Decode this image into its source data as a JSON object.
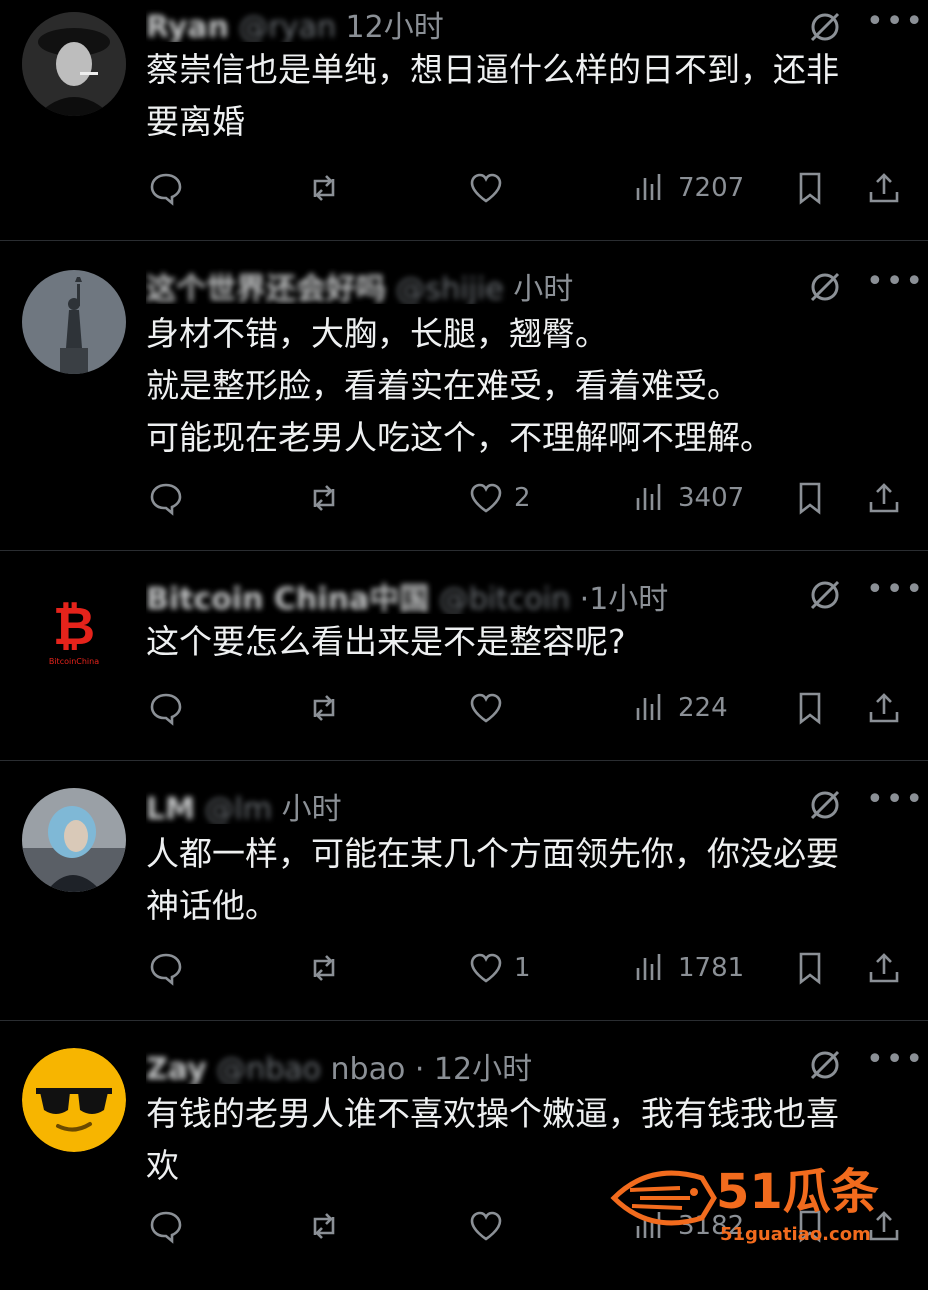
{
  "posts": [
    {
      "name": "Ryan",
      "handle": "@ryan",
      "time": "12小时",
      "text_lines": [
        "蔡崇信也是单纯，想日逼什么样的日不到，还非",
        "要离婚"
      ],
      "likes": "",
      "views": "7207"
    },
    {
      "name": "这个世界还会好吗",
      "handle": "@shijie",
      "time": "小时",
      "text_lines": [
        "身材不错，大胸，长腿，翘臀。",
        "就是整形脸，看着实在难受，看着难受。",
        "可能现在老男人吃这个，不理解啊不理解。"
      ],
      "likes": "2",
      "views": "3407"
    },
    {
      "name": "Bitcoin China中国",
      "handle": "@bitcoin",
      "time": "·1小时",
      "text_lines": [
        "这个要怎么看出来是不是整容呢?"
      ],
      "likes": "",
      "views": "224"
    },
    {
      "name": "LM",
      "handle": "@lm",
      "time": "小时",
      "text_lines": [
        "人都一样，可能在某几个方面领先你，你没必要",
        "神话他。"
      ],
      "likes": "1",
      "views": "1781"
    },
    {
      "name": "Zay",
      "handle": "@nbao",
      "time": "nbao · 12小时",
      "text_lines": [
        "有钱的老男人谁不喜欢操个嫩逼，我有钱我也喜",
        "欢"
      ],
      "likes": "",
      "views": "3182"
    }
  ],
  "more_label": "•••",
  "watermark": {
    "brand": "51瓜条",
    "url": "51guatiao.com"
  },
  "colors": {
    "background": "#000000",
    "text": "#e7e9ea",
    "muted": "#8b9096",
    "divider": "#2a2d31",
    "watermark": "#f26b1d"
  }
}
